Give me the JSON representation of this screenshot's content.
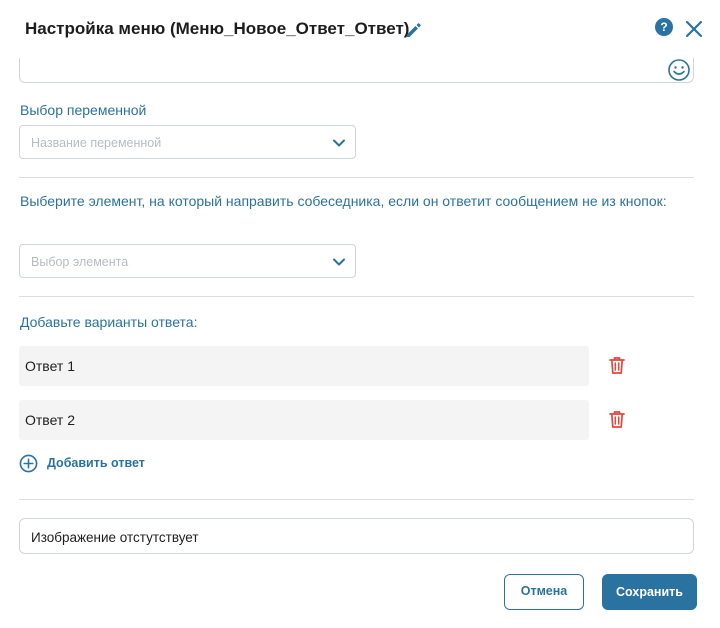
{
  "header": {
    "title": "Настройка меню (Меню_Новое_Ответ_Ответ)",
    "help_label": "?"
  },
  "variable": {
    "label": "Выбор переменной",
    "placeholder": "Название переменной"
  },
  "redirect": {
    "label": "Выберите элемент, на который направить собеседника, если он ответит сообщением не из кнопок:",
    "placeholder": "Выбор элемента"
  },
  "answers": {
    "label": "Добавьте варианты ответа:",
    "items": [
      {
        "label": "Ответ 1"
      },
      {
        "label": "Ответ 2"
      }
    ],
    "add_label": "Добавить ответ"
  },
  "image": {
    "text": "Изображение отстутствует"
  },
  "footer": {
    "cancel_label": "Отмена",
    "save_label": "Сохранить"
  },
  "colors": {
    "accent": "#2a73a0",
    "danger": "#e0483e",
    "field_bg": "#f4f4f4",
    "border": "#d0d5da"
  },
  "icons": {
    "edit": "pencil-icon",
    "help": "help-icon",
    "close": "close-icon",
    "emoji": "smile-icon",
    "dropdown": "chevron-down-icon",
    "delete": "trash-icon",
    "add": "plus-circle-icon"
  }
}
